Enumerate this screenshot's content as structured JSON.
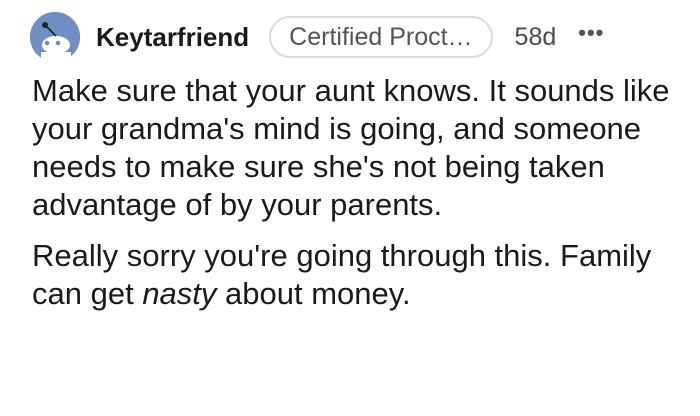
{
  "comment": {
    "username": "Keytarfriend",
    "flair": "Certified Proct…",
    "age": "58d",
    "more_label": "•••",
    "paragraphs": [
      {
        "text": "Make sure that your aunt knows. It sounds like your grandma's mind is going, and someone needs to make sure she's not being taken advantage of by your parents."
      },
      {
        "before": "Really sorry you're going through this. Family can get ",
        "emphasis": "nasty",
        "after": " about money."
      }
    ]
  },
  "icons": {
    "avatar": "reddit-snoo-avatar-icon",
    "more": "more-options-icon"
  },
  "colors": {
    "avatar_bg": "#6f8fc4",
    "text": "#1a1a1b",
    "flair_border": "#dadada",
    "muted": "#545454"
  }
}
